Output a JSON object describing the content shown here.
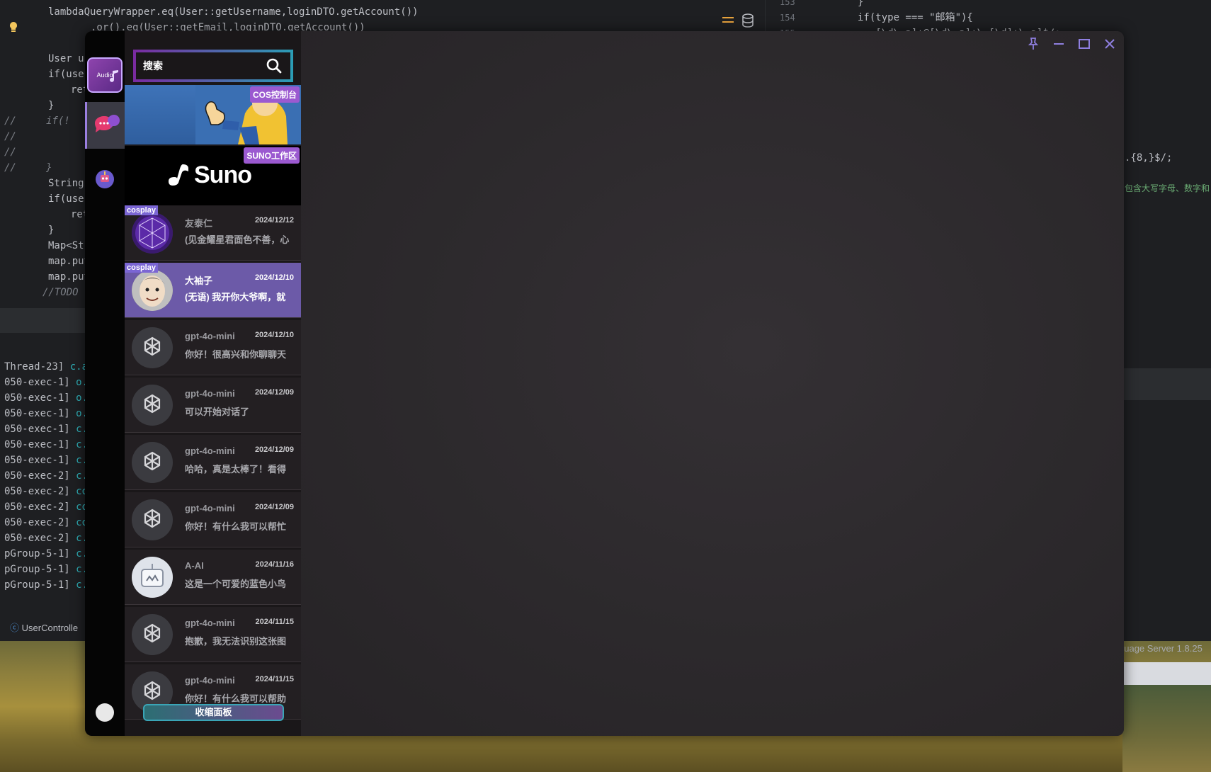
{
  "ide": {
    "code_left": [
      {
        "text": "lambdaQueryWrapper.eq(User::getUsername,loginDTO.getAccount())",
        "indent": 68
      },
      {
        "text": ".or().eq(User::getEmail,loginDTO.getAccount())",
        "indent": 128
      },
      {
        "text": "User us",
        "indent": 68
      },
      {
        "text": "if(user",
        "indent": 68
      },
      {
        "text": "ret",
        "indent": 100
      },
      {
        "text": "}",
        "indent": 68
      },
      {
        "text": "//     if(!",
        "indent": 6
      },
      {
        "text": "//",
        "indent": 6
      },
      {
        "text": "//",
        "indent": 6
      },
      {
        "text": "//     }",
        "indent": 6
      },
      {
        "text": "String",
        "indent": 68
      },
      {
        "text": "if(user",
        "indent": 68
      },
      {
        "text": "ret",
        "indent": 100
      },
      {
        "text": "}",
        "indent": 68
      },
      {
        "text": "Map<Str",
        "indent": 68
      },
      {
        "text": "map.put",
        "indent": 68
      },
      {
        "text": "map.put",
        "indent": 68
      },
      {
        "text": "//TODO ",
        "indent": 60
      }
    ],
    "code_right": [
      {
        "num": "153",
        "text": "}"
      },
      {
        "num": "154",
        "text": "if(type === \"邮箱\"){"
      },
      {
        "num": "155",
        "text": "...[\\d\\.a]+@[\\d\\.a]+\\.[\\d]+\\.a]$/;"
      }
    ],
    "code_right_extra": [
      ".{8,}$/;",
      "包含大写字母、数字和"
    ],
    "console": [
      {
        "thread": "Thread-23]",
        "cls": "c.a"
      },
      {
        "thread": "050-exec-1]",
        "cls": "o.a"
      },
      {
        "thread": "050-exec-1]",
        "cls": "o.s"
      },
      {
        "thread": "050-exec-1]",
        "cls": "o.s"
      },
      {
        "thread": "050-exec-1]",
        "cls": "c.a"
      },
      {
        "thread": "050-exec-1]",
        "cls": "c.a"
      },
      {
        "thread": "050-exec-1]",
        "cls": "c.a"
      },
      {
        "thread": "050-exec-2]",
        "cls": "c.a"
      },
      {
        "thread": "050-exec-2]",
        "cls": "com"
      },
      {
        "thread": "050-exec-2]",
        "cls": "com"
      },
      {
        "thread": "050-exec-2]",
        "cls": "com"
      },
      {
        "thread": "050-exec-2]",
        "cls": "c.a"
      },
      {
        "thread": "pGroup-5-1]",
        "cls": "c.a"
      },
      {
        "thread": "pGroup-5-1]",
        "cls": "c.a"
      },
      {
        "thread": "pGroup-5-1]",
        "cls": "c.a"
      }
    ],
    "breadcrumb": "UserControlle",
    "status_right": "guage Server 1.8.25"
  },
  "app": {
    "rail": {
      "audio_label": "Audio"
    },
    "search": {
      "placeholder": "搜索"
    },
    "banners": [
      {
        "tag": "COS控制台"
      },
      {
        "tag": "SUNO工作区",
        "logo_text": "Suno"
      }
    ],
    "conversations": [
      {
        "name": "友泰仁",
        "date": "2024/12/12",
        "preview": "(见金耀星君面色不善，心",
        "tag": "cosplay",
        "avatar": "crystal",
        "active": false
      },
      {
        "name": "大袖子",
        "date": "2024/12/10",
        "preview": "(无语) 我开你大爷啊，就",
        "tag": "cosplay",
        "avatar": "face",
        "active": true
      },
      {
        "name": "gpt-4o-mini",
        "date": "2024/12/10",
        "preview": "你好！很高兴和你聊聊天",
        "tag": "",
        "avatar": "openai",
        "active": false
      },
      {
        "name": "gpt-4o-mini",
        "date": "2024/12/09",
        "preview": "可以开始对话了",
        "tag": "",
        "avatar": "openai",
        "active": false
      },
      {
        "name": "gpt-4o-mini",
        "date": "2024/12/09",
        "preview": "哈哈，真是太棒了！看得",
        "tag": "",
        "avatar": "openai",
        "active": false
      },
      {
        "name": "gpt-4o-mini",
        "date": "2024/12/09",
        "preview": "你好！有什么我可以帮忙",
        "tag": "",
        "avatar": "openai",
        "active": false
      },
      {
        "name": "A-AI",
        "date": "2024/11/16",
        "preview": "这是一个可爱的蓝色小鸟",
        "tag": "",
        "avatar": "robot",
        "active": false
      },
      {
        "name": "gpt-4o-mini",
        "date": "2024/11/15",
        "preview": "抱歉，我无法识别这张图",
        "tag": "",
        "avatar": "openai",
        "active": false
      },
      {
        "name": "gpt-4o-mini",
        "date": "2024/11/15",
        "preview": "你好！有什么我可以帮助",
        "tag": "",
        "avatar": "openai",
        "active": false
      }
    ],
    "collapse_label": "收缩面板",
    "colors": {
      "accent": "#6c5aa8",
      "tag": "#7b66d4",
      "banner_tag": "#9b59d0"
    }
  }
}
